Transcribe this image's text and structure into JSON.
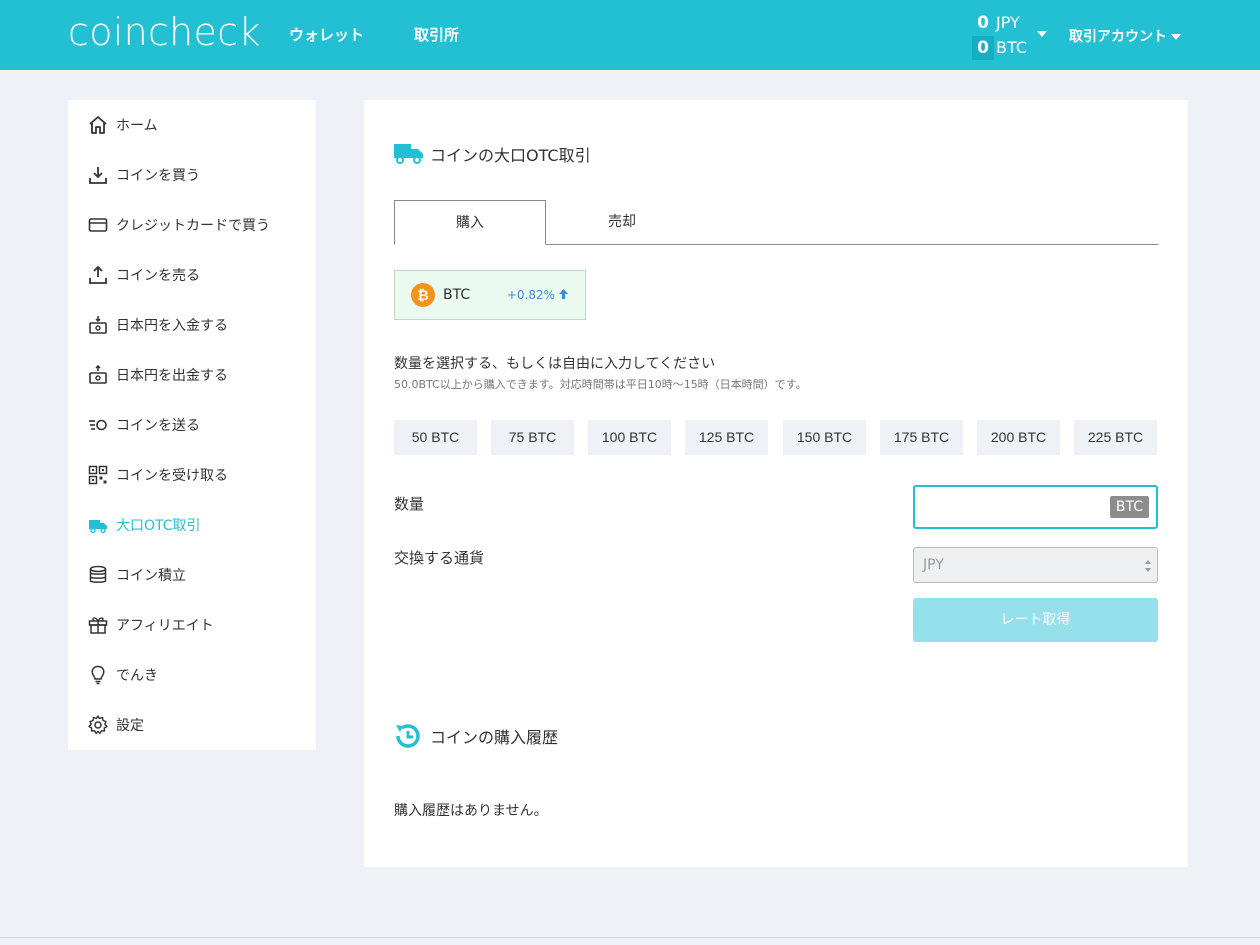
{
  "header": {
    "logo": "coincheck",
    "nav": {
      "wallet": "ウォレット",
      "exchange": "取引所"
    },
    "balances": [
      {
        "amount": "0",
        "currency": "JPY"
      },
      {
        "amount": "0",
        "currency": "BTC"
      }
    ],
    "account_label": "取引アカウント"
  },
  "sidebar": {
    "items": [
      {
        "label": "ホーム",
        "icon": "home-icon"
      },
      {
        "label": "コインを買う",
        "icon": "download-icon"
      },
      {
        "label": "クレジットカードで買う",
        "icon": "credit-card-icon"
      },
      {
        "label": "コインを売る",
        "icon": "upload-icon"
      },
      {
        "label": "日本円を入金する",
        "icon": "deposit-icon"
      },
      {
        "label": "日本円を出金する",
        "icon": "withdraw-icon"
      },
      {
        "label": "コインを送る",
        "icon": "send-icon"
      },
      {
        "label": "コインを受け取る",
        "icon": "qr-code-icon"
      },
      {
        "label": "大口OTC取引",
        "icon": "truck-icon",
        "active": true
      },
      {
        "label": "コイン積立",
        "icon": "database-icon"
      },
      {
        "label": "アフィリエイト",
        "icon": "gift-icon"
      },
      {
        "label": "でんき",
        "icon": "lightbulb-icon"
      },
      {
        "label": "設定",
        "icon": "gear-icon"
      }
    ]
  },
  "main": {
    "title": "コインの大口OTC取引",
    "tabs": {
      "buy": "購入",
      "sell": "売却"
    },
    "coin": {
      "logo": "₿",
      "name": "BTC",
      "change": "+0.82%"
    },
    "instruction": "数量を選択する、もしくは自由に入力してください",
    "instruction_sub": "50.0BTC以上から購入できます。対応時間帯は平日10時〜15時（日本時間）です。",
    "quantity_options": [
      "50 BTC",
      "75 BTC",
      "100 BTC",
      "125 BTC",
      "150 BTC",
      "175 BTC",
      "200 BTC",
      "225 BTC"
    ],
    "quantity_label": "数量",
    "quantity_value": "",
    "quantity_unit": "BTC",
    "currency_label": "交換する通貨",
    "currency_selected": "JPY",
    "rate_button": "レート取得",
    "history_title": "コインの購入履歴",
    "history_empty": "購入履歴はありません。"
  },
  "colors": {
    "brand": "#23c0d4",
    "active_text": "#23c0d4",
    "btc_orange": "#f7931a",
    "change_blue": "#3a8ddb"
  }
}
